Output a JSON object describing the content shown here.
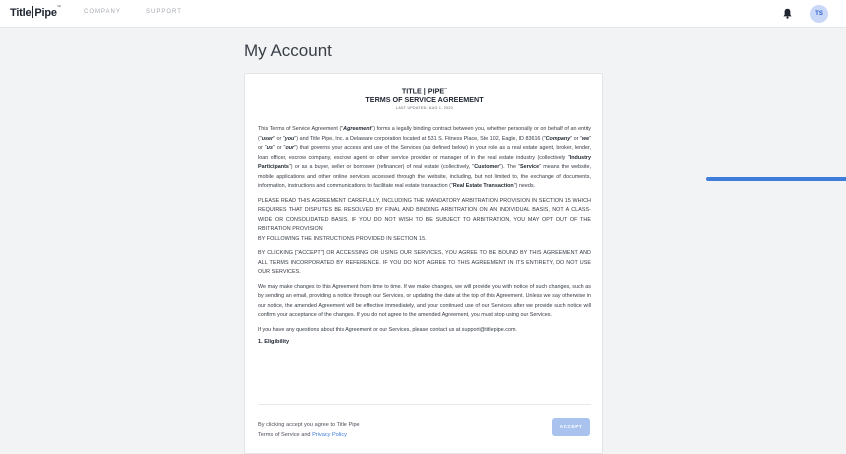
{
  "header": {
    "logo_left": "Title",
    "logo_right": "Pipe",
    "logo_mark": "™",
    "nav": [
      "COMPANY",
      "SUPPORT"
    ],
    "avatar_initials": "TS",
    "icons": [
      "bell-icon"
    ]
  },
  "page": {
    "title": "My Account"
  },
  "terms": {
    "heading_line1": "TITLE | PIPE",
    "heading_mark": "™",
    "heading_line2": "TERMS OF SERVICE AGREEMENT",
    "last_updated": "LAST UPDATED: AUG 1, 2020",
    "p1": {
      "t1": "This Terms of Service Agreement (\"",
      "b1": "Agreement",
      "t2": "\") forms a legally binding contract between you, whether personally or on behalf of an entity (\"",
      "b2": "user",
      "t3": "\" or \"",
      "b3": "you",
      "t4": "\") and Title Pipe, Inc. a Delaware corporation located at 531 S. Fitness Place, Ste 102, Eagle, ID 83616 (\"",
      "b4": "Company",
      "t5": "\" or \"",
      "b5": "we",
      "t6": "\" or \"",
      "b6": "us",
      "t7": "\" or \"",
      "b7": "our",
      "t8": "\") that governs your access and use of the Services (as defined below) in your role as a real estate agent, broker, lender, loan officer, escrow company, escrow agent or other service provider or manager of in the real estate industry (collectively \"",
      "b8": "Industry Participants",
      "t9": "\") or as a buyer, seller or borrower (refinancer) of real estate (collectively, \"",
      "b9": "Customer",
      "t10": "\"). The \"",
      "b10": "Service",
      "t11": "\" means the website, mobile applications and other online services accessed through the website, including, but not limited to, the exchange of documents, information, instructions and communications to facilitate real estate transaction (\"",
      "b11": "Real Estate Transaction",
      "t12": "\") needs."
    },
    "p2_main": "PLEASE READ THIS AGREEMENT CAREFULLY, INCLUDING THE MANDATORY ARBITRATION PROVISION IN SECTION 15 WHICH REQUIRES THAT DISPUTES BE RESOLVED BY FINAL AND BINDING ARBITRATION ON AN INDIVIDUAL BASIS, NOT A CLASS-WIDE OR CONSOLIDATED BASIS. IF YOU DO NOT WISH TO BE SUBJECT TO ARBITRATION, YOU MAY OPT OUT OF THE RBITRATION PROVISION",
    "p2_tail": "BY FOLLOWING THE INSTRUCTIONS PROVIDED IN SECTION 15.",
    "p3": "BY CLICKING [\"ACCEPT\"] OR ACCESSING OR USING OUR SERVICES, YOU AGREE TO BE BOUND BY THIS AGREEMENT AND ALL TERMS INCORPORATED BY REFERENCE. IF YOU DO NOT AGREE TO THIS AGREEMENT IN ITS ENTIRETY, DO NOT USE OUR SERVICES.",
    "p4": "We may make changes to this Agreement from time to time. If we make changes, we will provide you with notice of such changes, such as by sending an email, providing a notice through our Services, or updating the date at the top of this Agreement. Unless we say otherwise in our notice, the amended Agreement will be effective immediately, and your continued use of our Services after we provide such notice will confirm your acceptance of the changes. If you do not agree to the amended Agreement, you must stop using our Services.",
    "p5": "If you have any questions about this Agreement or our Services, please contact us at support@titlepipe.com.",
    "section1": "1. Eligibility"
  },
  "footer": {
    "line1": "By clicking accept you agree to Title Pipe",
    "line2_prefix": "Terms of Service and ",
    "privacy_link": "Privacy Policy",
    "accept_label": "ACCEPT"
  },
  "colors": {
    "accent": "#3f7ddb",
    "accept_button": "#a9c3ee",
    "avatar_bg": "#c9d8f6"
  }
}
